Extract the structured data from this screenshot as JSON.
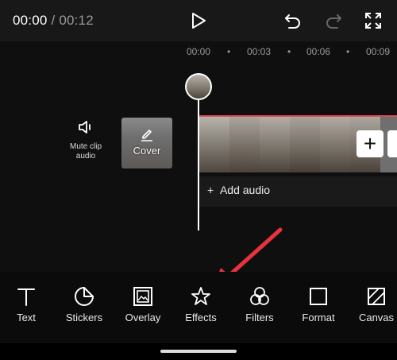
{
  "player": {
    "current_time": "00:00",
    "separator": " / ",
    "duration": "00:12"
  },
  "toolbar_top": {
    "icons": [
      "play-icon",
      "undo-icon",
      "redo-icon",
      "fullscreen-icon"
    ]
  },
  "ruler": {
    "marks": [
      "00:00",
      "00:03",
      "00:06",
      "00:09"
    ]
  },
  "track": {
    "mute_label": "Mute clip audio",
    "cover_label": "Cover",
    "add_audio_label": "Add audio",
    "add_clip_symbol": "+",
    "accent_color": "#e04a5a"
  },
  "tools": [
    {
      "label": "Text",
      "icon": "text-icon"
    },
    {
      "label": "Stickers",
      "icon": "sticker-icon"
    },
    {
      "label": "Overlay",
      "icon": "overlay-icon"
    },
    {
      "label": "Effects",
      "icon": "effects-star-icon"
    },
    {
      "label": "Filters",
      "icon": "filters-icon"
    },
    {
      "label": "Format",
      "icon": "format-icon"
    },
    {
      "label": "Canvas",
      "icon": "canvas-icon"
    }
  ],
  "annotation": {
    "arrow_color": "#e8333f"
  }
}
